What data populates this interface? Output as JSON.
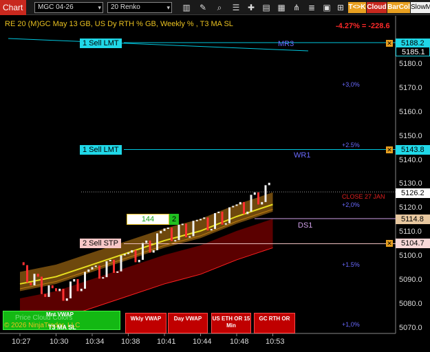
{
  "toolbar": {
    "tab": "Chart",
    "instrument": "MGC 04-26",
    "period": "20 Renko",
    "btn_tk": "T<>K",
    "btn_cloud": "Cloud",
    "btn_barcol": "BarCol",
    "btn_slow": "SlowM"
  },
  "chart": {
    "title": "RE 20  (M)GC May 13 GB, US Dy RTH % GB, Weekly % , T3 MA SL",
    "pnl": "-4.27% = -228.6",
    "levels": {
      "sell1_top": "1 Sell LMT",
      "sell1_mid": "1 Sell LMT",
      "sell2": "2 Sell STP",
      "mr3": "MR3",
      "wr1": "WR1",
      "ds1": "DS1",
      "close_label": "CLOSE 27 JAN",
      "order_qty": "144",
      "order_count": "2"
    },
    "price_tags": [
      "5188.2",
      "5185.1",
      "5143.8",
      "5126.2",
      "5114.8",
      "5104.7"
    ],
    "y_ticks": [
      "5180.0",
      "5170.0",
      "5160.0",
      "5150.0",
      "5140.0",
      "5130.0",
      "5120.0",
      "5110.0",
      "5100.0",
      "5090.0",
      "5080.0",
      "5070.0"
    ],
    "x_ticks": [
      "10:27",
      "10:30",
      "10:34",
      "10:38",
      "10:41",
      "10:44",
      "10:48",
      "10:53"
    ],
    "pct_labels": [
      "+3,0%",
      "+2.5%",
      "+2,0%",
      "+1.5%",
      "+1,0%"
    ],
    "buttons": {
      "vwap": "Mnt VWAP",
      "wkly_vwap": "Wkly VWAP",
      "day_vwap": "Day VWAP",
      "us_eth": "US ETH OR 15 Min",
      "gc_rth": "GC RTH OR"
    },
    "legend": {
      "cloud": "Price Cloud Colors",
      "copyright": "© 2026 NinjaTrader, LLC",
      "t3": "T3 MA SL"
    }
  },
  "chart_data": {
    "type": "line",
    "title": "RE 20  (M)GC May 13 GB, US Dy RTH % GB, Weekly % , T3 MA SL",
    "x": [
      "10:27",
      "10:30",
      "10:34",
      "10:38",
      "10:41",
      "10:44",
      "10:48",
      "10:53"
    ],
    "ylim": [
      5066,
      5192
    ],
    "series": [
      {
        "name": "Price",
        "values": [
          5094,
          5082,
          5092,
          5098,
          5108,
          5112,
          5118,
          5128
        ]
      },
      {
        "name": "T3 MA SL",
        "values": [
          5088,
          5091,
          5096,
          5101,
          5106,
          5110,
          5116,
          5121
        ]
      }
    ],
    "levels": [
      {
        "label": "1 Sell LMT",
        "value": 5188.2
      },
      {
        "label": "1 Sell LMT",
        "value": 5143.8
      },
      {
        "label": "2 Sell STP",
        "value": 5104.7
      },
      {
        "label": "CLOSE 27 JAN",
        "value": 5126.2
      }
    ],
    "colors": {
      "up": "#f0f0f0",
      "down": "#ff3030",
      "ma": "#e8e020",
      "cloud_up": "#8a5a10",
      "cloud_down": "#7a0000",
      "level": "#00c8e0"
    }
  }
}
